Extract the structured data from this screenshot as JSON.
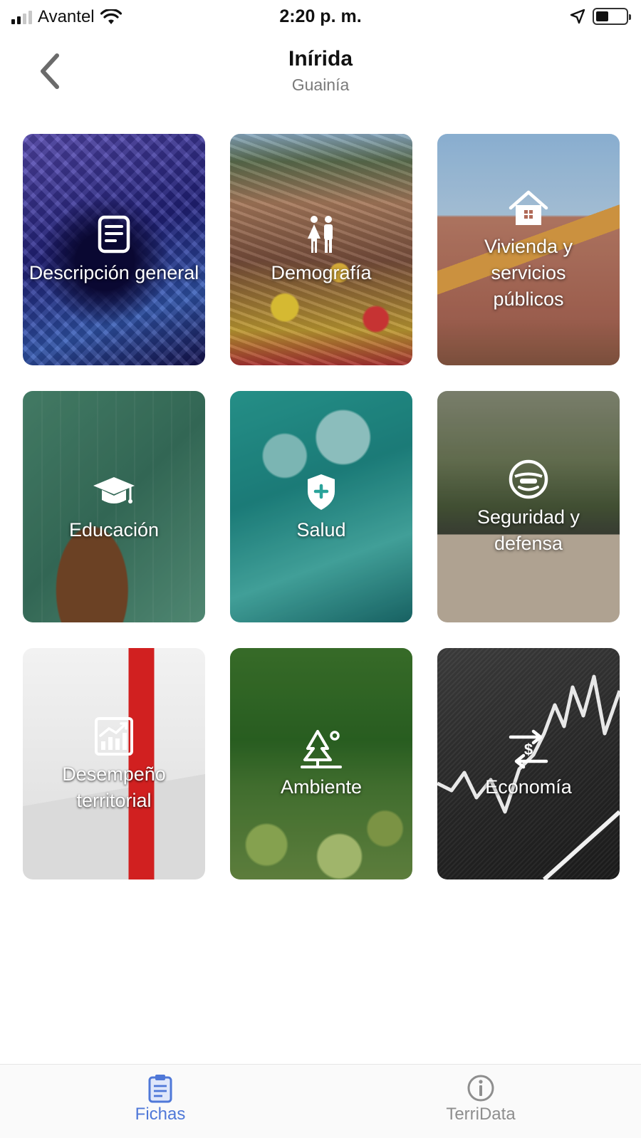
{
  "status_bar": {
    "carrier": "Avantel",
    "time": "2:20 p. m."
  },
  "header": {
    "title": "Inírida",
    "subtitle": "Guainía"
  },
  "cards": [
    {
      "label": "Descripción general",
      "icon": "document-icon"
    },
    {
      "label": "Demografía",
      "icon": "people-icon"
    },
    {
      "label": "Vivienda y servicios públicos",
      "icon": "house-icon"
    },
    {
      "label": "Educación",
      "icon": "graduation-cap-icon"
    },
    {
      "label": "Salud",
      "icon": "health-shield-icon"
    },
    {
      "label": "Seguridad y defensa",
      "icon": "security-badge-icon"
    },
    {
      "label": "Desempeño territorial",
      "icon": "bar-chart-icon"
    },
    {
      "label": "Ambiente",
      "icon": "tree-icon"
    },
    {
      "label": "Economía",
      "icon": "currency-exchange-icon"
    }
  ],
  "tab_bar": {
    "tabs": [
      {
        "label": "Fichas",
        "icon": "clipboard-icon",
        "active": true
      },
      {
        "label": "TerriData",
        "icon": "info-icon",
        "active": false
      }
    ],
    "active_color": "#4f78d8",
    "inactive_color": "#8e8e8e"
  }
}
